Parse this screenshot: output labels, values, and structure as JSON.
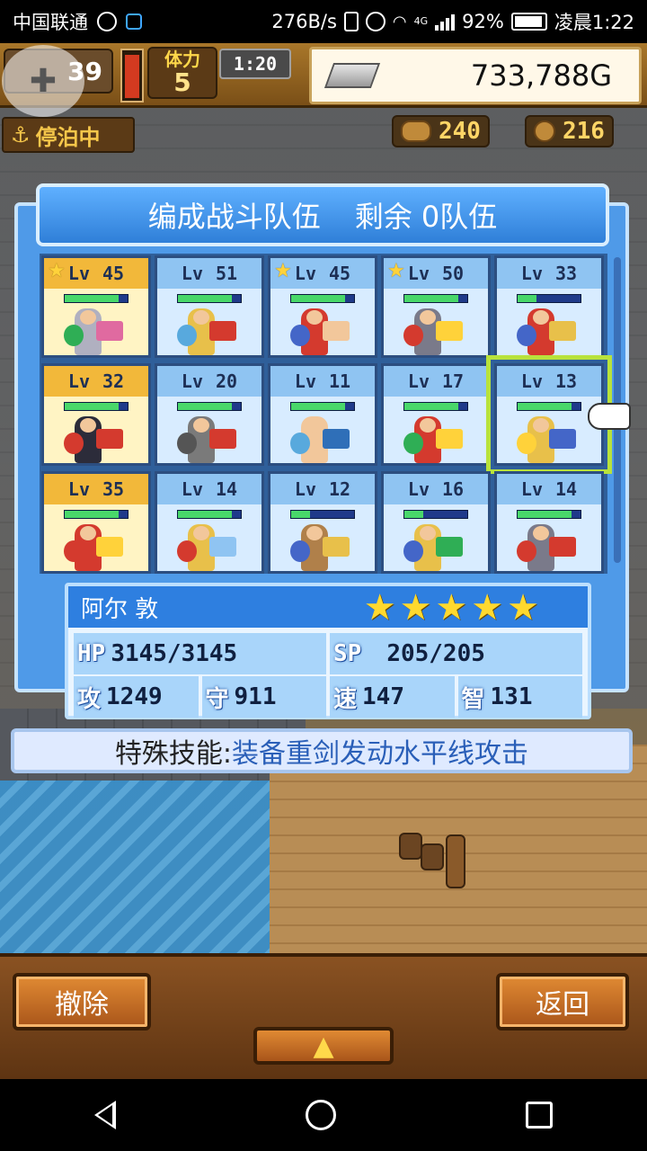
{
  "status_bar": {
    "carrier": "中国联通",
    "net_speed": "276B/s",
    "network": "4G",
    "battery": "92%",
    "time": "凌晨1:22"
  },
  "hud": {
    "level": "39",
    "stamina_label": "体力",
    "stamina_value": "5",
    "timer": "1:20",
    "gold": "733,788G",
    "anchor_label": "停泊中",
    "resource_wood": "240",
    "resource_coin": "216"
  },
  "dialog": {
    "title_left": "编成战斗队伍",
    "title_right": "剩余 0队伍"
  },
  "roster": [
    {
      "lv": "45",
      "star": true,
      "highlight": true,
      "hp": 0.85,
      "colors": [
        "#b0b0c0",
        "#e06aa0",
        "#2fae55"
      ]
    },
    {
      "lv": "51",
      "star": false,
      "highlight": false,
      "hp": 0.85,
      "colors": [
        "#e8c04a",
        "#d43a2e",
        "#58a9dd"
      ]
    },
    {
      "lv": "45",
      "star": true,
      "highlight": false,
      "hp": 0.85,
      "colors": [
        "#d43a2e",
        "#f2c79b",
        "#4466c8"
      ]
    },
    {
      "lv": "50",
      "star": true,
      "highlight": false,
      "hp": 0.85,
      "colors": [
        "#7a7a8a",
        "#ffd23a",
        "#d43a2e"
      ]
    },
    {
      "lv": "33",
      "star": false,
      "highlight": false,
      "hp": 0.3,
      "colors": [
        "#d43a2e",
        "#e8c04a",
        "#4466c8"
      ]
    },
    {
      "lv": "32",
      "star": false,
      "highlight": true,
      "hp": 0.85,
      "colors": [
        "#2c2c3a",
        "#d43a2e",
        "#d43a2e"
      ]
    },
    {
      "lv": "20",
      "star": false,
      "highlight": false,
      "hp": 0.85,
      "colors": [
        "#7a7a7a",
        "#d43a2e",
        "#555"
      ]
    },
    {
      "lv": "11",
      "star": false,
      "highlight": false,
      "hp": 0.85,
      "colors": [
        "#f2c79b",
        "#2f6fb8",
        "#58a9dd"
      ]
    },
    {
      "lv": "17",
      "star": false,
      "highlight": false,
      "hp": 0.85,
      "colors": [
        "#d43a2e",
        "#ffd23a",
        "#2fae55"
      ]
    },
    {
      "lv": "13",
      "star": false,
      "highlight": false,
      "hp": 0.85,
      "selected": true,
      "colors": [
        "#e8c04a",
        "#4466c8",
        "#ffd23a"
      ]
    },
    {
      "lv": "35",
      "star": false,
      "highlight": true,
      "hp": 0.85,
      "colors": [
        "#d43a2e",
        "#ffd23a",
        "#d43a2e"
      ]
    },
    {
      "lv": "14",
      "star": false,
      "highlight": false,
      "hp": 0.85,
      "colors": [
        "#e8c04a",
        "#8fc4f2",
        "#d43a2e"
      ]
    },
    {
      "lv": "12",
      "star": false,
      "highlight": false,
      "hp": 0.3,
      "colors": [
        "#b0804a",
        "#e8c04a",
        "#4466c8"
      ]
    },
    {
      "lv": "16",
      "star": false,
      "highlight": false,
      "hp": 0.3,
      "colors": [
        "#e8c04a",
        "#2fae55",
        "#4466c8"
      ]
    },
    {
      "lv": "14",
      "star": false,
      "highlight": false,
      "hp": 0.85,
      "colors": [
        "#7a7a8a",
        "#d43a2e",
        "#d43a2e"
      ]
    }
  ],
  "lv_label": "Lv",
  "selected_unit": {
    "name": "阿尔 敦",
    "stars": 5,
    "hp_label": "HP",
    "hp": "3145/3145",
    "sp_label": "SP",
    "sp": "205/205",
    "atk_label": "攻",
    "atk": "1249",
    "def_label": "守",
    "def": "911",
    "spd_label": "速",
    "spd": "147",
    "int_label": "智",
    "int": "131"
  },
  "skill": {
    "label": "特殊技能:",
    "value": "装备重剑发动水平线攻击"
  },
  "buttons": {
    "remove": "撤除",
    "back": "返回",
    "up": "▲"
  },
  "colors": {
    "panel_blue": "#4f9ae8",
    "gold_cell": "#fff4c4",
    "select_outline": "#b8e23c"
  }
}
